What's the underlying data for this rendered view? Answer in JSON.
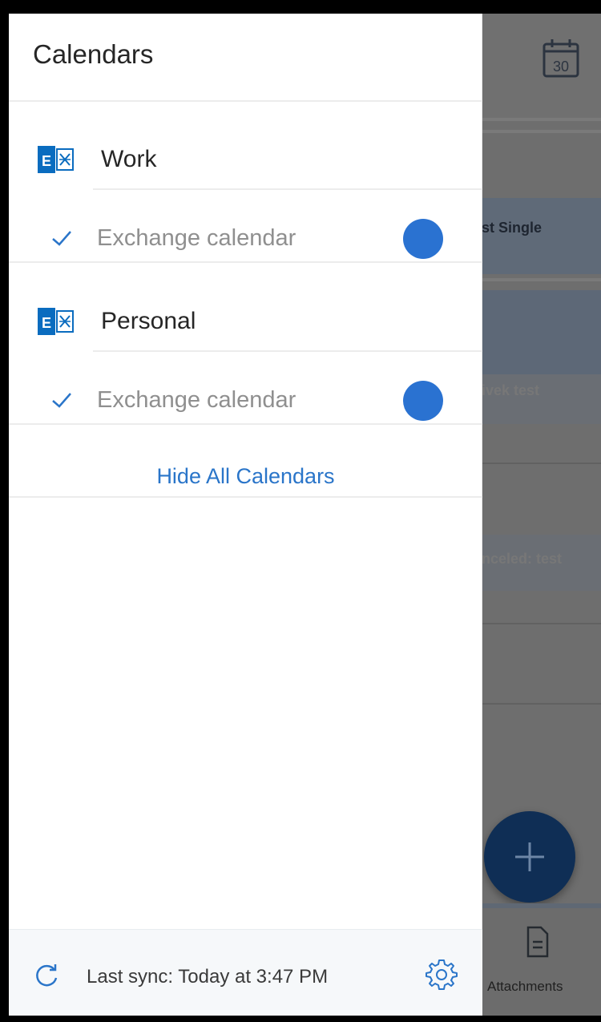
{
  "drawer": {
    "title": "Calendars",
    "accounts": [
      {
        "name": "Work",
        "icon": "exchange-icon",
        "calendars": [
          {
            "name": "Exchange calendar",
            "checked": true,
            "color": "#2a72d1"
          }
        ]
      },
      {
        "name": "Personal",
        "icon": "exchange-icon",
        "calendars": [
          {
            "name": "Exchange calendar",
            "checked": true,
            "color": "#2a72d1"
          }
        ]
      }
    ],
    "hide_all_label": "Hide All Calendars",
    "footer": {
      "sync_icon": "refresh-icon",
      "sync_text": "Last sync: Today at 3:47 PM",
      "settings_icon": "gear-icon"
    }
  },
  "background": {
    "calendar_icon_day": "30",
    "events": [
      {
        "title": "st Single"
      },
      {
        "title": "ivek test"
      },
      {
        "title": "nceled: test"
      }
    ],
    "fab_icon": "plus-icon",
    "bottom_tab_label": "Attachments",
    "bottom_tab_icon": "document-icon"
  },
  "colors": {
    "accent": "#2a75c9",
    "calendar_dot": "#2a72d1",
    "exchange_blue": "#0a6cbf"
  }
}
